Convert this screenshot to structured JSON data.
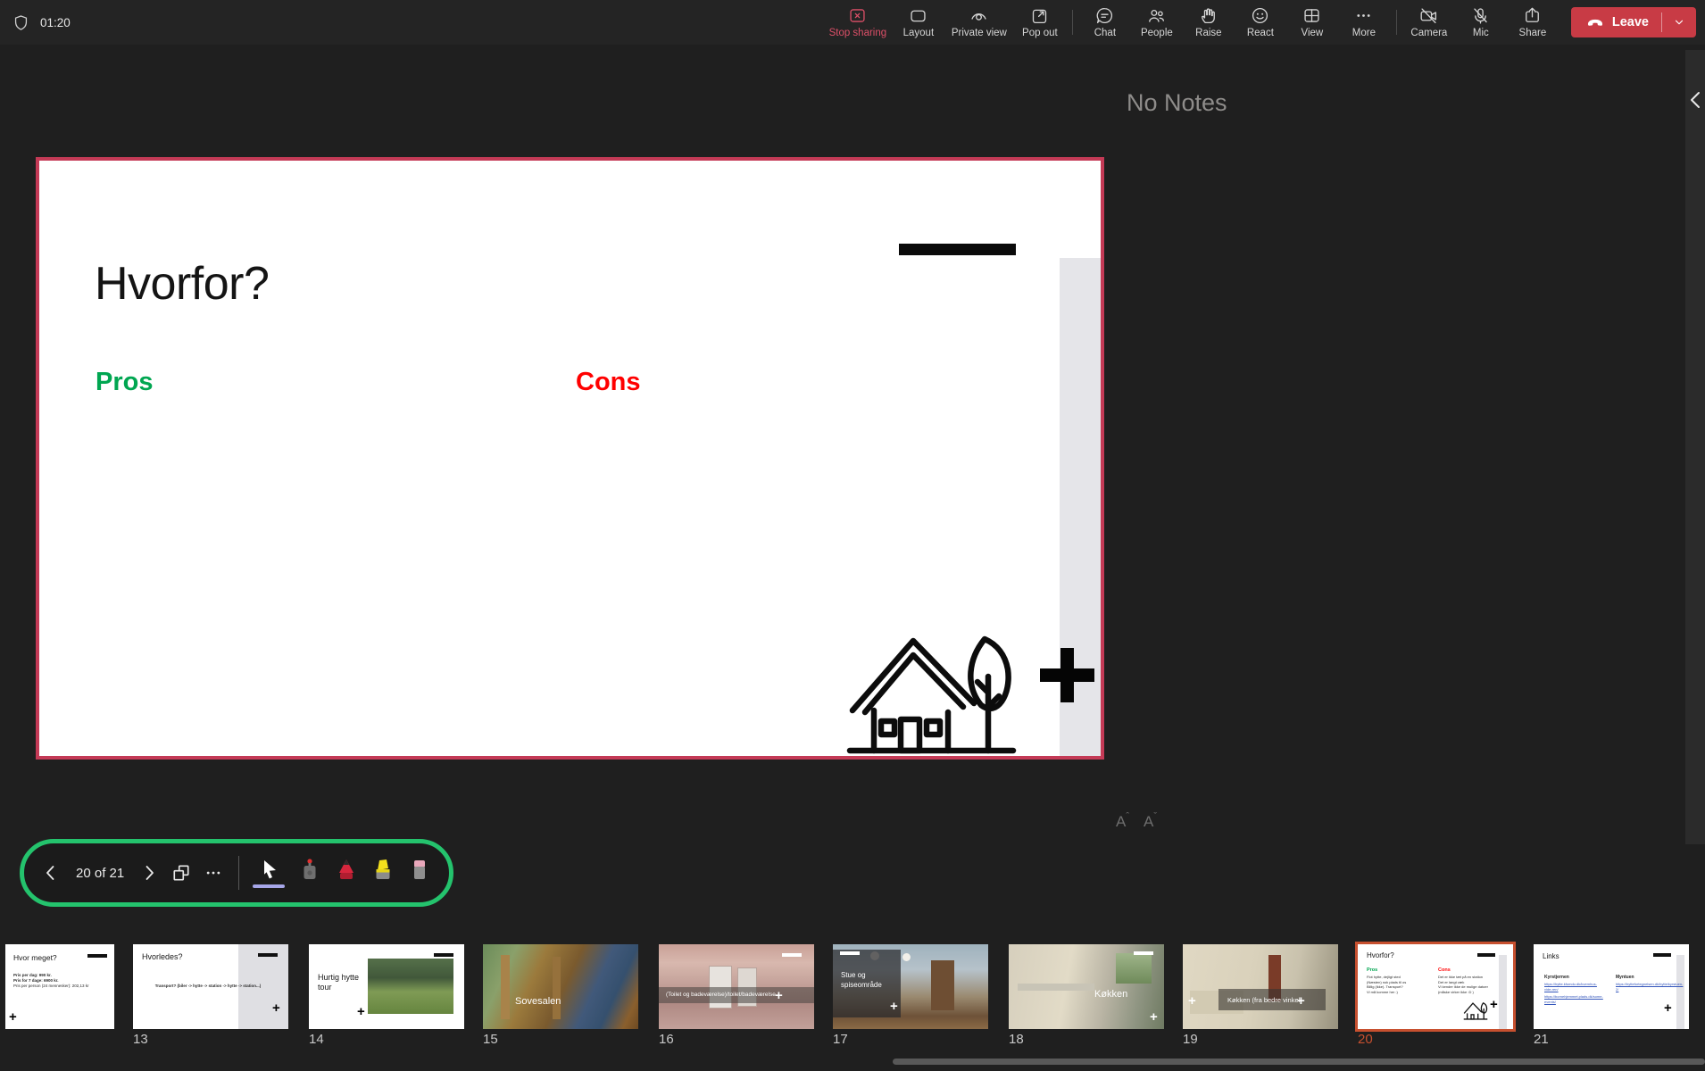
{
  "topbar": {
    "timer": "01:20",
    "stop_sharing_label": "Stop sharing",
    "layout_label": "Layout",
    "private_view_label": "Private view",
    "pop_out_label": "Pop out",
    "chat_label": "Chat",
    "people_label": "People",
    "raise_label": "Raise",
    "react_label": "React",
    "view_label": "View",
    "more_label": "More",
    "camera_label": "Camera",
    "mic_label": "Mic",
    "share_label": "Share",
    "leave_label": "Leave"
  },
  "slide": {
    "title": "Hvorfor?",
    "pros_label": "Pros",
    "cons_label": "Cons"
  },
  "notes_panel": {
    "empty_text": "No Notes",
    "font_label_increase": "A",
    "font_label_decrease": "A",
    "increase_mark": "ˆ",
    "decrease_mark": "ˇ"
  },
  "presenter_toolbar": {
    "slide_counter": "20 of 21"
  },
  "colors": {
    "pros_green": "#00A651",
    "cons_red": "#FF0000",
    "slide_border_red": "#C43A56",
    "toolbar_outline_green": "#24C36D",
    "active_thumb_orange": "#C7502F",
    "stop_sharing_red": "#DD4F68",
    "leave_button_red": "#C83B45",
    "pointer_underline": "#A6A6E8"
  },
  "filmstrip": {
    "slides": [
      {
        "number": "",
        "title": "Hvor meget?",
        "bullets": {
          "0": "Pris per dag: 990 kr.",
          "1": "Pris for 7 dage: 6900 kr.",
          "2": "Pris per person (24 mennesker): 202,13 kr"
        }
      },
      {
        "number": "13",
        "title": "Hvorledes?",
        "body": "Transport? (biler -> hytte -> station -> hytte -> station...)"
      },
      {
        "number": "14",
        "title": "Hurtig hytte tour"
      },
      {
        "number": "15",
        "caption": "Sovesalen"
      },
      {
        "number": "16",
        "caption": "(Toilet og badeværelse)/toilet/badeværelse"
      },
      {
        "number": "17",
        "caption_line1": "Stue og",
        "caption_line2": "spiseområde"
      },
      {
        "number": "18",
        "caption": "Køkken"
      },
      {
        "number": "19",
        "caption": "Køkken (fra bedre vinkel)"
      },
      {
        "number": "20",
        "title": "Hvorfor?",
        "pros_label": "Pros",
        "cons_label": "Cons",
        "pros_bullets": {
          "0": "Flot hytte, dejligt sted",
          "1": "(Næsten) nok plads til os",
          "2": "Billig (ikke). Transport?",
          "3": "Vi må komme her :)"
        },
        "cons_bullets": {
          "0": "Det er ikke tæt på en station",
          "1": "Det er langt væk",
          "2": "Vi kender ikke de mulige datoer",
          "3": "(måske virker ikke :D )"
        }
      },
      {
        "number": "21",
        "title": "Links",
        "col1_header": "Kyrstjernen",
        "col2_header": "Myntuen",
        "col1_links": {
          "0": "https://hytte.kfumdu.dk/kvernhus-vide-ren/",
          "1": "https://bornehjemmet.plads.dk/some-events/"
        },
        "col2_links": {
          "0": "https://hyttefortegnelsen.dk/hytte/kyrstuen-2/"
        }
      }
    ]
  }
}
